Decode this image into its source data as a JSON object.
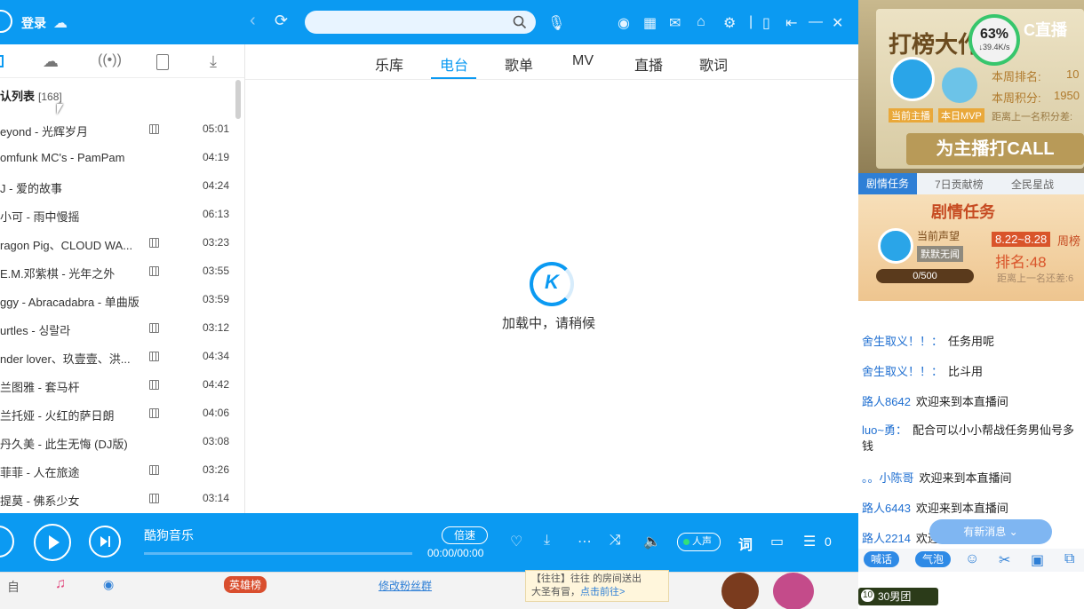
{
  "kugou": {
    "login": "登录",
    "list_title": "认列表",
    "list_count": "[168]",
    "songs": [
      {
        "title": "eyond - 光辉岁月",
        "dur": "05:01",
        "mv": true
      },
      {
        "title": "omfunk MC's - PamPam",
        "dur": "04:19",
        "mv": false
      },
      {
        "title": "J - 爱的故事",
        "dur": "04:24",
        "mv": false
      },
      {
        "title": "小可 - 雨中慢摇",
        "dur": "06:13",
        "mv": false
      },
      {
        "title": "ragon Pig、CLOUD WA...",
        "dur": "03:23",
        "mv": true
      },
      {
        "title": "E.M.邓紫棋 - 光年之外",
        "dur": "03:55",
        "mv": true
      },
      {
        "title": "ggy - Abracadabra - 单曲版",
        "dur": "03:59",
        "mv": false
      },
      {
        "title": "urtles - 싱랄라",
        "dur": "03:12",
        "mv": true
      },
      {
        "title": "nder lover、玖壹壹、洪...",
        "dur": "04:34",
        "mv": true
      },
      {
        "title": "兰图雅 - 套马杆",
        "dur": "04:42",
        "mv": true
      },
      {
        "title": "兰托娅 - 火红的萨日朗",
        "dur": "04:06",
        "mv": true
      },
      {
        "title": "丹久美 - 此生无悔 (DJ版)",
        "dur": "03:08",
        "mv": false
      },
      {
        "title": "菲菲 - 人在旅途",
        "dur": "03:26",
        "mv": true
      },
      {
        "title": "提莫 - 佛系少女",
        "dur": "03:14",
        "mv": true
      }
    ],
    "tabs": [
      "乐库",
      "电台",
      "歌单",
      "MV",
      "直播",
      "歌词"
    ],
    "loading_text": "加载中，请稍候",
    "loading_logo": "K",
    "player": {
      "track": "酷狗音乐",
      "speed": "倍速",
      "time": "00:00/00:00",
      "voice": "人声",
      "lyric_label": "词",
      "queue_count": "0"
    },
    "taskbar": {
      "a": "自",
      "b": "英雄榜",
      "c": "修改粉丝群",
      "d": "【往往】往往",
      "e": "的房间送出",
      "f": "大圣有冒，",
      "g": "点击前往>"
    }
  },
  "live": {
    "banner_title": "打榜大作",
    "pct": "63%",
    "speed": "↓39.4K/s",
    "ctv": "C直播",
    "rank_label": "本周排名:",
    "rank": "10",
    "score_label": "本周积分:",
    "score": "1950",
    "current_host": "当前主播",
    "mvp": "本日MVP",
    "gap": "距离上一名积分差:",
    "callout": "为主播打CALL",
    "subtabs": [
      "剧情任务",
      "7日贡献榜",
      "全民星战"
    ],
    "task": {
      "title": "剧情任务",
      "group_label": "当前声望",
      "team": "默默无闻",
      "progress": "0/500",
      "dates": "8.22~8.28",
      "week": "周榜",
      "rank": "排名:48",
      "gap": "距离上一名还差:6"
    },
    "messages": [
      {
        "user": "舍生取义！！：",
        "text": "任务用呢"
      },
      {
        "user": "舍生取义！！：",
        "text": "比斗用"
      },
      {
        "user": "路人8642",
        "text": "欢迎来到本直播间"
      },
      {
        "user": "luo~勇：",
        "text": "配合可以小小帮战任务男仙号多钱"
      },
      {
        "user": "。。小陈哥",
        "text": "欢迎来到本直播间"
      },
      {
        "user": "路人6443",
        "text": "欢迎来到本直播间"
      },
      {
        "user": "路人2214",
        "text": "欢迎来到本直播间"
      }
    ],
    "new_msg": "有新消息 ⌄",
    "btn_talk": "喊话",
    "btn_bubble": "气泡",
    "fan": "30男团",
    "fan_level": "10"
  }
}
